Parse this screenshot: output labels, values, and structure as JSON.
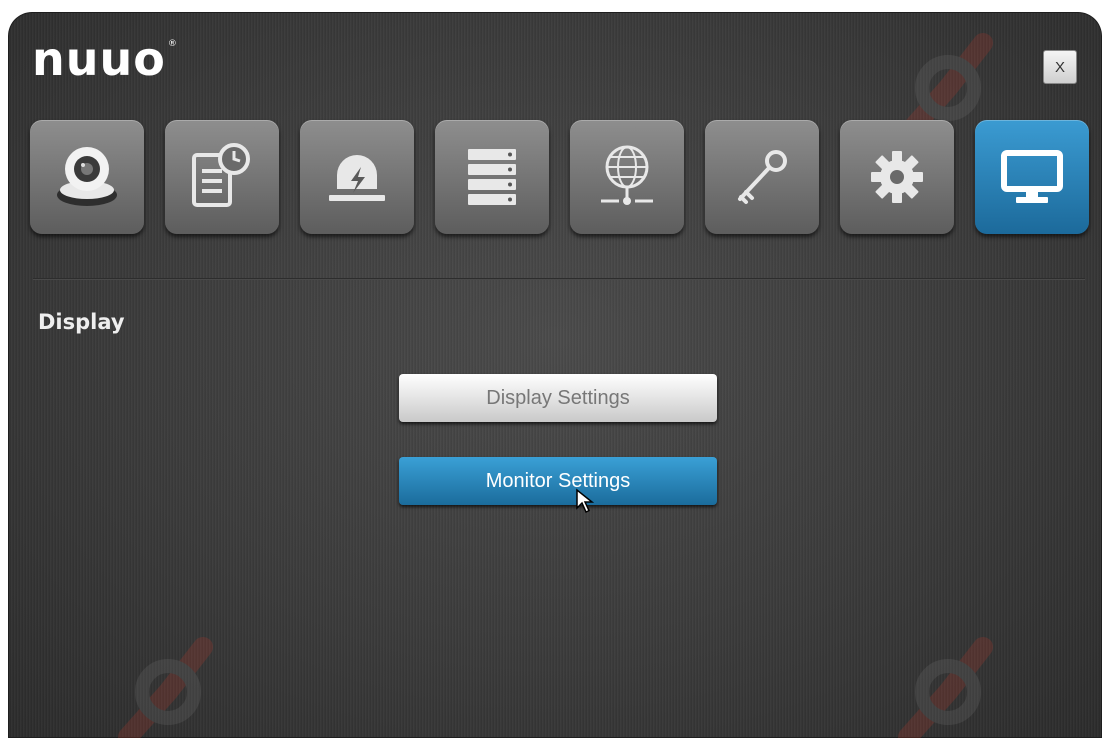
{
  "header": {
    "logo_text": "nuuo",
    "logo_mark": "®",
    "close_label": "X"
  },
  "nav": {
    "items": [
      {
        "icon": "camera-icon",
        "active": false
      },
      {
        "icon": "schedule-icon",
        "active": false
      },
      {
        "icon": "alarm-icon",
        "active": false
      },
      {
        "icon": "storage-icon",
        "active": false
      },
      {
        "icon": "network-icon",
        "active": false
      },
      {
        "icon": "key-icon",
        "active": false
      },
      {
        "icon": "gear-icon",
        "active": false
      },
      {
        "icon": "monitor-icon",
        "active": true
      }
    ]
  },
  "section": {
    "title": "Display"
  },
  "buttons": {
    "display_settings": "Display Settings",
    "monitor_settings": "Monitor Settings"
  },
  "colors": {
    "accent": "#2a86bf",
    "tile_gray": "#6f6f6f",
    "background": "#3a3a3a"
  }
}
